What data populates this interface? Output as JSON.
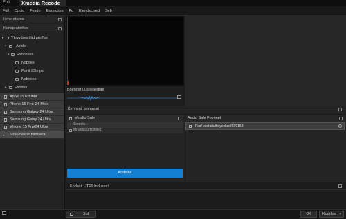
{
  "titlebar": {
    "app_menu": "Full",
    "title": "Xmedia Recode"
  },
  "menubar": {
    "items": [
      "Full",
      "Opcio",
      "Fesdo",
      "Eszesztes",
      "Fo",
      "Elendschied",
      "Seb"
    ]
  },
  "sidebar": {
    "header": "Ismeretszes",
    "subheader": "Kenapratorfias",
    "tree": [
      {
        "label": "Ykrvv bestittid profffao",
        "arrow": "▸",
        "indent": 0
      },
      {
        "label": "Apple",
        "arrow": "▾",
        "indent": 1
      },
      {
        "label": "Rsoosees",
        "arrow": "▾",
        "indent": 2
      },
      {
        "label": "Nsboes",
        "arrow": "",
        "indent": 3
      },
      {
        "label": "Ponit 83lmps",
        "arrow": "",
        "indent": 3
      },
      {
        "label": "Nsboese",
        "arrow": "",
        "indent": 3
      },
      {
        "label": "Exodes",
        "arrow": "▸",
        "indent": 1
      }
    ],
    "devices": [
      "Apoe 15 Prnlbbii",
      "Phone 15 Fr:o-24 Mox",
      "Samsung Galaxy 24 Ultra",
      "Samsung Gaiay 24 Ultra",
      "Vhione 15 Prp/24 Ultra"
    ],
    "selected_device": "Nsso oeshe bsrhsect"
  },
  "preview": {
    "label": "Boeoosr uusoeaediae"
  },
  "settings": {
    "title": "Kennsnii fanmnsst",
    "video": {
      "header": "Vosdio Sale",
      "option1": "Sreeols",
      "option2": "Mrasgsourtssttiies"
    },
    "audio": {
      "header": "Audio Sale Fnonnet",
      "value": "Fesf coetatiulkeyeoksd/S09168"
    },
    "start_button": "Kodolas"
  },
  "status": {
    "text": "Kodasi: UTF9  Induses!"
  },
  "bottombar": {
    "left_button": "Sut",
    "ok_button": "OK",
    "right_button": "Kodolas"
  },
  "colors": {
    "accent": "#1480d4",
    "background": "#1e1e1e"
  }
}
